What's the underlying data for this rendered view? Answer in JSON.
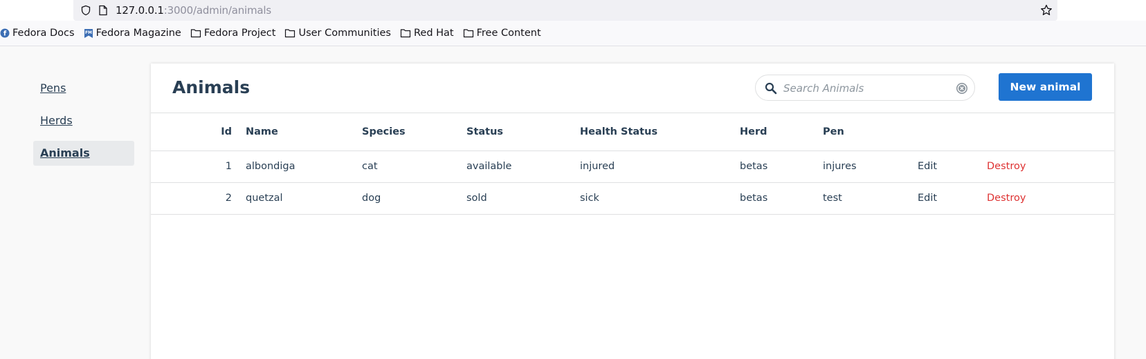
{
  "browser": {
    "url_host": "127.0.0.1",
    "url_rest": ":3000/admin/animals",
    "bookmarks": [
      {
        "label": "Fedora Docs",
        "icon": "fedora-icon"
      },
      {
        "label": "Fedora Magazine",
        "icon": "fedora-magazine-icon"
      },
      {
        "label": "Fedora Project",
        "icon": "folder-icon"
      },
      {
        "label": "User Communities",
        "icon": "folder-icon"
      },
      {
        "label": "Red Hat",
        "icon": "folder-icon"
      },
      {
        "label": "Free Content",
        "icon": "folder-icon"
      }
    ]
  },
  "sidebar": {
    "items": [
      {
        "label": "Pens",
        "active": false
      },
      {
        "label": "Herds",
        "active": false
      },
      {
        "label": "Animals",
        "active": true
      }
    ]
  },
  "header": {
    "title": "Animals",
    "search_placeholder": "Search Animals",
    "new_button": "New animal"
  },
  "table": {
    "columns": [
      "Id",
      "Name",
      "Species",
      "Status",
      "Health Status",
      "Herd",
      "Pen"
    ],
    "rows": [
      {
        "id": "1",
        "name": "albondiga",
        "species": "cat",
        "status": "available",
        "health_status": "injured",
        "herd": "betas",
        "pen": "injures",
        "edit": "Edit",
        "destroy": "Destroy"
      },
      {
        "id": "2",
        "name": "quetzal",
        "species": "dog",
        "status": "sold",
        "health_status": "sick",
        "herd": "betas",
        "pen": "test",
        "edit": "Edit",
        "destroy": "Destroy"
      }
    ]
  },
  "colors": {
    "primary_button": "#1f74d1",
    "destroy_link": "#de3232",
    "text": "#293f54"
  }
}
